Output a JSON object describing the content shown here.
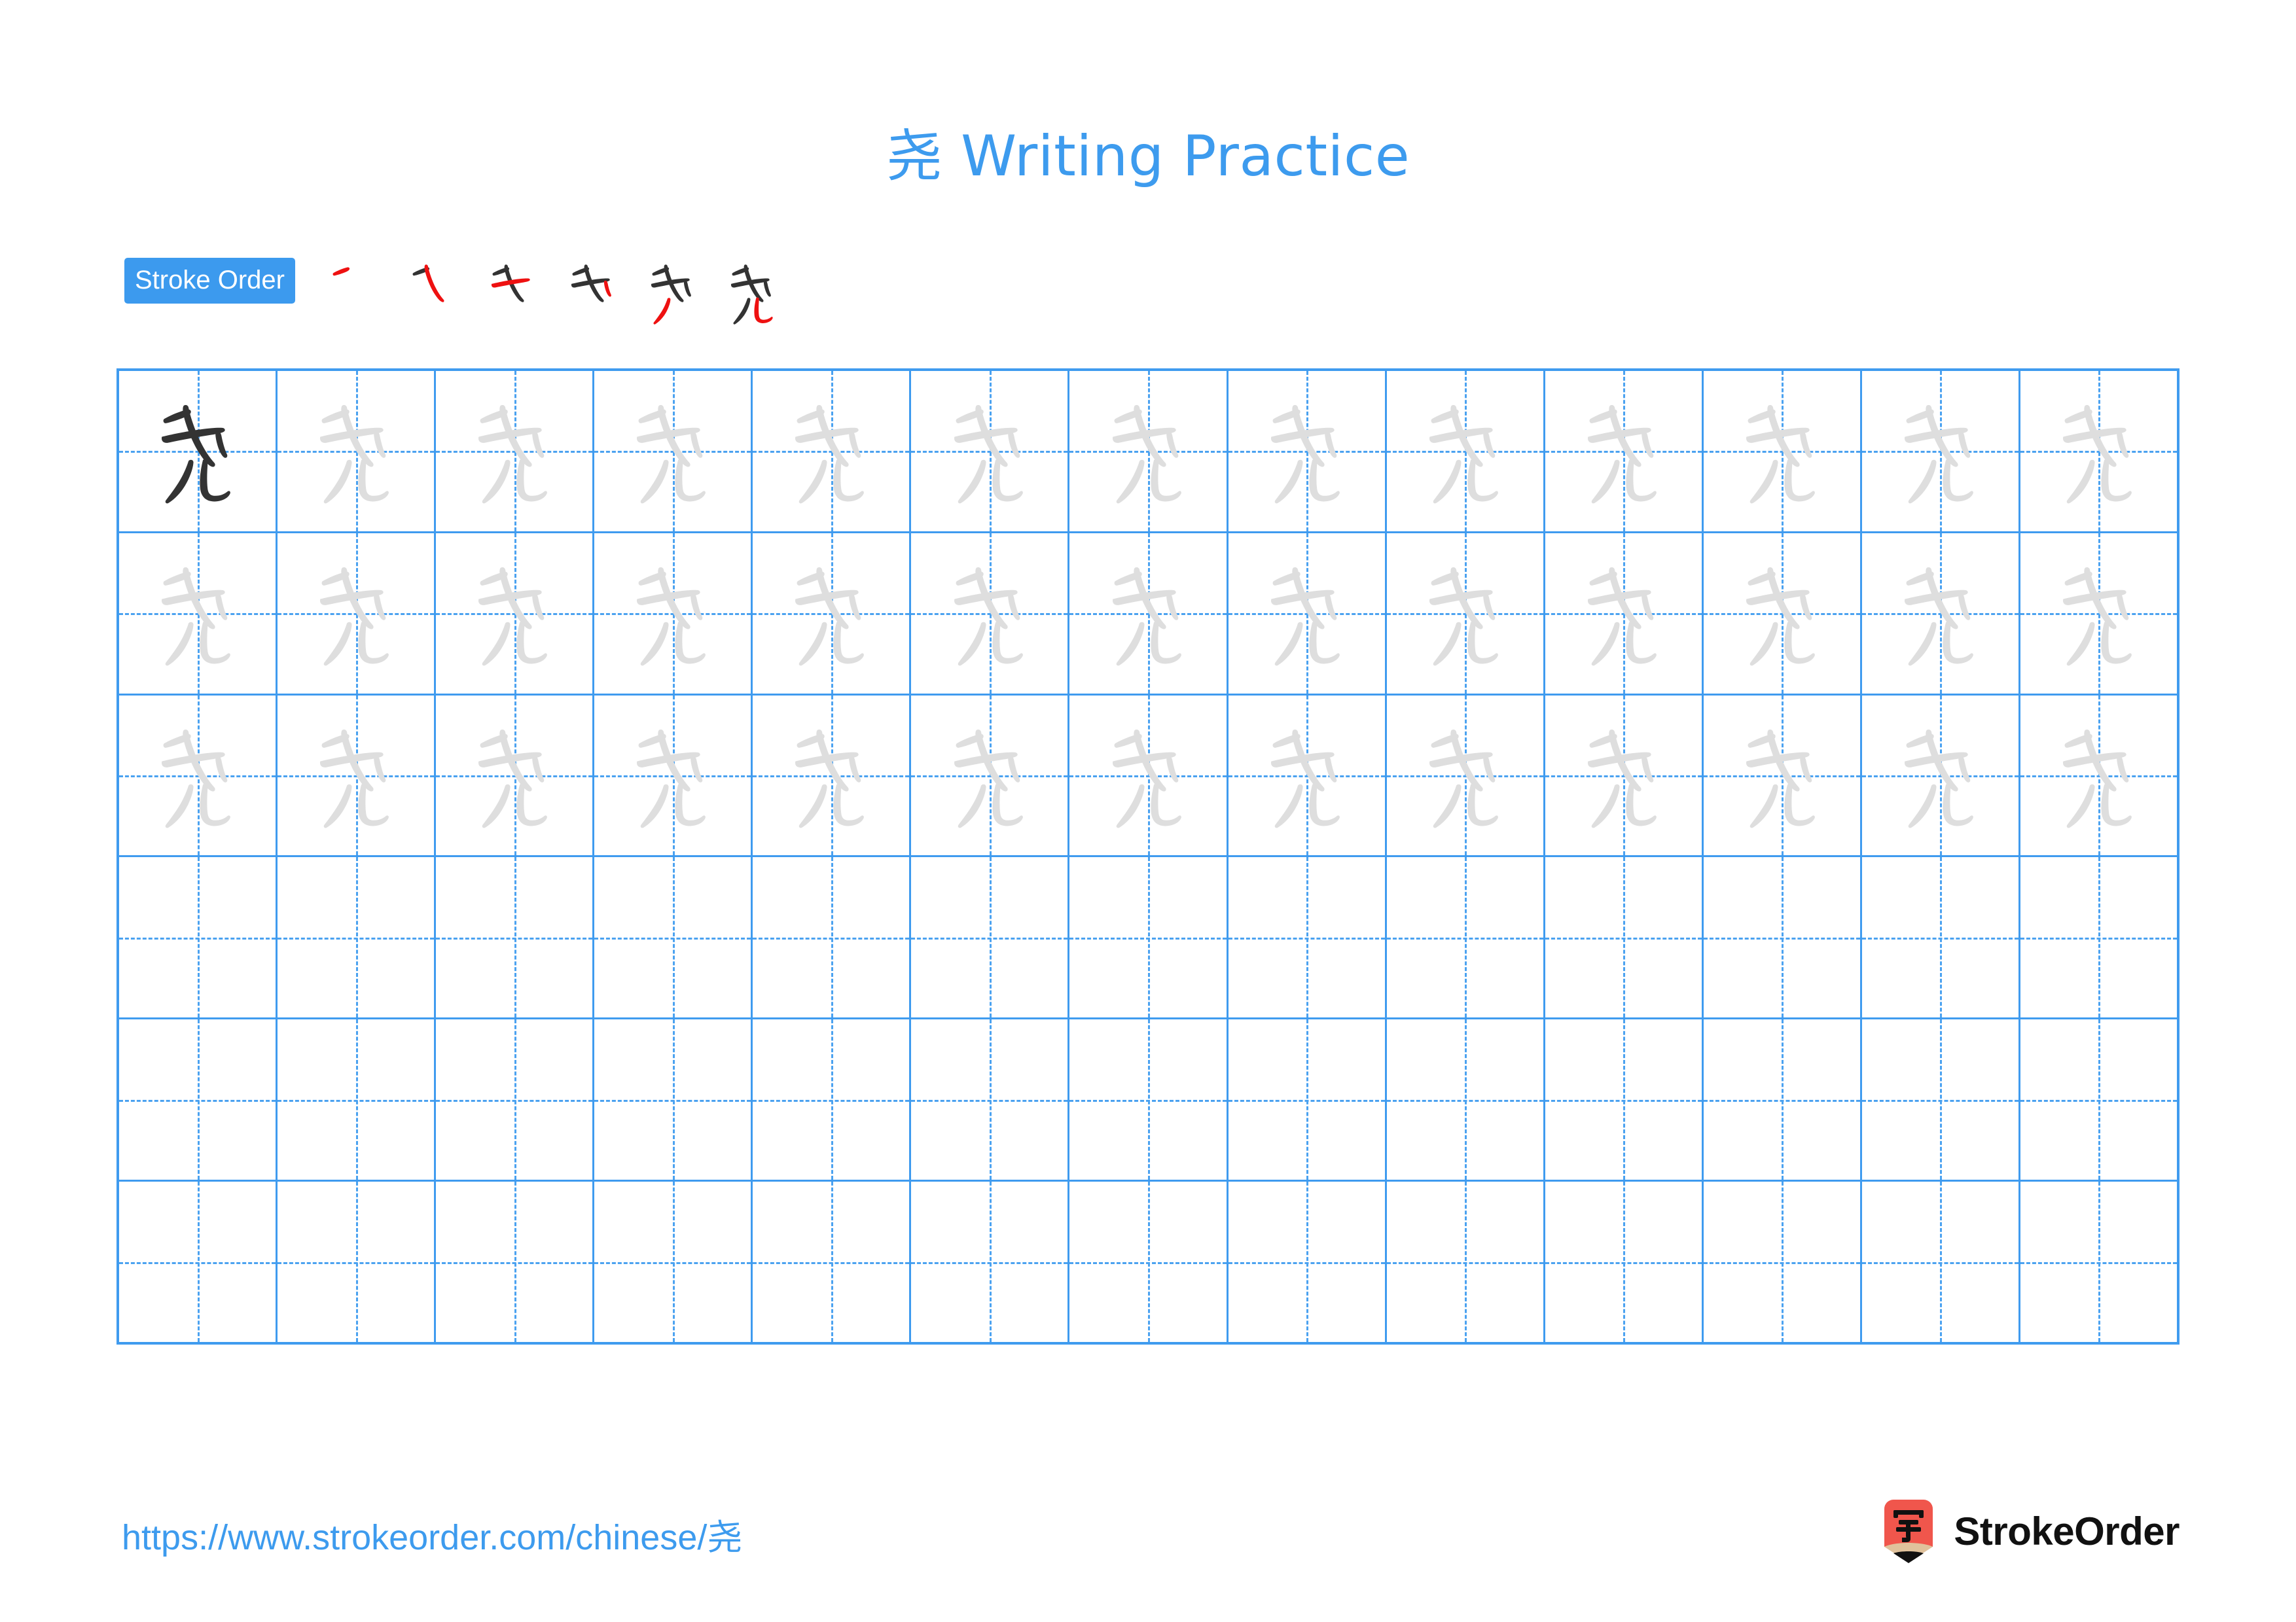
{
  "character": "尧",
  "title": "尧 Writing Practice",
  "colors": {
    "accent_blue": "#3d9bee",
    "grid_blue": "#3f9bef",
    "guide_blue": "#4ba2f0",
    "trace_gray": "#dedede",
    "ink_black": "#333333",
    "new_stroke_red": "#ee1111",
    "brand_red": "#f0564c",
    "pencil_tan": "#e0c29c"
  },
  "stroke_order": {
    "badge_label": "Stroke Order",
    "stroke_count": 6,
    "steps": [
      {
        "index": 1,
        "strokes_shown": 1,
        "new_stroke": 1
      },
      {
        "index": 2,
        "strokes_shown": 2,
        "new_stroke": 2
      },
      {
        "index": 3,
        "strokes_shown": 3,
        "new_stroke": 3
      },
      {
        "index": 4,
        "strokes_shown": 4,
        "new_stroke": 4
      },
      {
        "index": 5,
        "strokes_shown": 5,
        "new_stroke": 5
      },
      {
        "index": 6,
        "strokes_shown": 6,
        "new_stroke": 6
      }
    ]
  },
  "practice_grid": {
    "columns": 13,
    "rows": 6,
    "cells": [
      [
        "ink",
        "trace",
        "trace",
        "trace",
        "trace",
        "trace",
        "trace",
        "trace",
        "trace",
        "trace",
        "trace",
        "trace",
        "trace"
      ],
      [
        "trace",
        "trace",
        "trace",
        "trace",
        "trace",
        "trace",
        "trace",
        "trace",
        "trace",
        "trace",
        "trace",
        "trace",
        "trace"
      ],
      [
        "trace",
        "trace",
        "trace",
        "trace",
        "trace",
        "trace",
        "trace",
        "trace",
        "trace",
        "trace",
        "trace",
        "trace",
        "trace"
      ],
      [
        "empty",
        "empty",
        "empty",
        "empty",
        "empty",
        "empty",
        "empty",
        "empty",
        "empty",
        "empty",
        "empty",
        "empty",
        "empty"
      ],
      [
        "empty",
        "empty",
        "empty",
        "empty",
        "empty",
        "empty",
        "empty",
        "empty",
        "empty",
        "empty",
        "empty",
        "empty",
        "empty"
      ],
      [
        "empty",
        "empty",
        "empty",
        "empty",
        "empty",
        "empty",
        "empty",
        "empty",
        "empty",
        "empty",
        "empty",
        "empty",
        "empty"
      ]
    ]
  },
  "footer": {
    "url": "https://www.strokeorder.com/chinese/尧",
    "brand_name": "StrokeOrder",
    "brand_icon_character": "字"
  }
}
